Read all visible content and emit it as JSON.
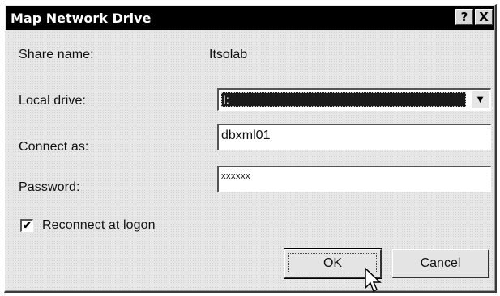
{
  "window": {
    "title": "Map Network Drive",
    "help_label": "?",
    "close_label": "X"
  },
  "form": {
    "share_name_label": "Share name:",
    "share_name_value": "Itsolab",
    "local_drive_label": "Local drive:",
    "local_drive_value": "I:",
    "connect_as_label": "Connect as:",
    "connect_as_value": "dbxml01",
    "password_label": "Password:",
    "password_value": "xxxxxx",
    "reconnect_label": "Reconnect at logon",
    "reconnect_checked": true
  },
  "buttons": {
    "ok_label": "OK",
    "cancel_label": "Cancel"
  },
  "icons": {
    "dropdown": "chevron-down-icon",
    "cursor": "mouse-pointer-icon",
    "check": "check-icon"
  },
  "colors": {
    "titlebar": "#000000",
    "dialog_bg": "#e6e6e6",
    "selection": "#1a1a1a"
  }
}
